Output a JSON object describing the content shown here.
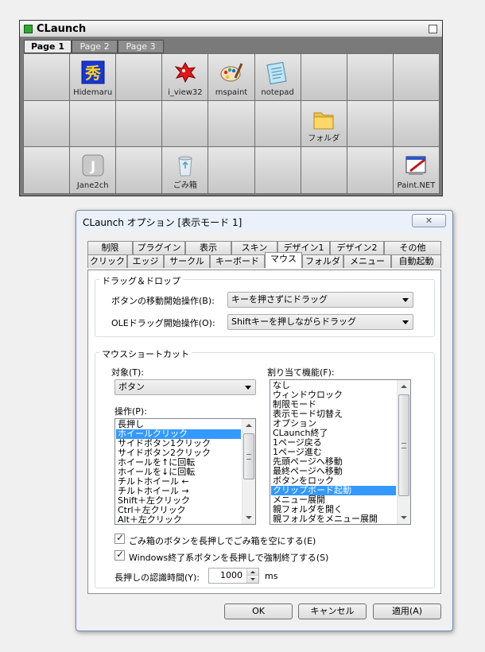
{
  "launcher": {
    "title": "CLaunch",
    "tabs": [
      {
        "label": "Page 1",
        "active": true
      },
      {
        "label": "Page 2",
        "active": false
      },
      {
        "label": "Page 3",
        "active": false
      }
    ],
    "icons": [
      {
        "row": 0,
        "col": 1,
        "label": "Hidemaru",
        "icon": "hidemaru-icon"
      },
      {
        "row": 0,
        "col": 3,
        "label": "i_view32",
        "icon": "irfanview-icon"
      },
      {
        "row": 0,
        "col": 4,
        "label": "mspaint",
        "icon": "mspaint-icon"
      },
      {
        "row": 0,
        "col": 5,
        "label": "notepad",
        "icon": "notepad-icon"
      },
      {
        "row": 1,
        "col": 6,
        "label": "フォルダ",
        "icon": "folder-icon"
      },
      {
        "row": 2,
        "col": 1,
        "label": "Jane2ch",
        "icon": "jane2ch-icon"
      },
      {
        "row": 2,
        "col": 3,
        "label": "ごみ箱",
        "icon": "recycle-bin-icon"
      },
      {
        "row": 2,
        "col": 8,
        "label": "Paint.NET",
        "icon": "paintnet-icon"
      }
    ]
  },
  "dialog": {
    "title": "CLaunch オプション [表示モード 1]",
    "close_label": "✕",
    "tabs_row1": [
      "制限",
      "プラグイン",
      "表示",
      "スキン",
      "デザイン1",
      "デザイン2",
      "その他"
    ],
    "tabs_row2": [
      "クリック",
      "エッジ",
      "サークル",
      "キーボード",
      "マウス",
      "フォルダ",
      "メニュー",
      "自動起動"
    ],
    "active_tab": "マウス",
    "dragdrop": {
      "group_label": "ドラッグ＆ドロップ",
      "move_label": "ボタンの移動開始操作(B):",
      "move_value": "キーを押さずにドラッグ",
      "ole_label": "OLEドラッグ開始操作(O):",
      "ole_value": "Shiftキーを押しながらドラッグ"
    },
    "shortcut": {
      "group_label": "マウスショートカット",
      "target_label": "対象(T):",
      "target_value": "ボタン",
      "operation_label": "操作(P):",
      "operations": [
        "長押し",
        "ホイールクリック",
        "サイドボタン1クリック",
        "サイドボタン2クリック",
        "ホイールを↑に回転",
        "ホイールを↓に回転",
        "チルトホイール ←",
        "チルトホイール →",
        "Shift＋左クリック",
        "Ctrl＋左クリック",
        "Alt＋左クリック"
      ],
      "operation_selected": 1,
      "function_label": "割り当て機能(F):",
      "functions": [
        "なし",
        "ウィンドウロック",
        "制限モード",
        "表示モード切替え",
        "オプション",
        "CLaunch終了",
        "1ページ戻る",
        "1ページ進む",
        "先頭ページへ移動",
        "最終ページへ移動",
        "ボタンをロック",
        "クリップボード起動",
        "メニュー展開",
        "親フォルダを開く",
        "親フォルダをメニュー展開"
      ],
      "function_selected": 11,
      "check1_label": "ごみ箱のボタンを長押しでごみ箱を空にする(E)",
      "check1_checked": true,
      "check2_label": "Windows終了系ボタンを長押しで強制終了する(S)",
      "check2_checked": true,
      "hold_label": "長押しの認識時間(Y):",
      "hold_value": "1000",
      "hold_unit": "ms"
    },
    "buttons": {
      "ok": "OK",
      "cancel": "キャンセル",
      "apply": "適用(A)"
    }
  }
}
